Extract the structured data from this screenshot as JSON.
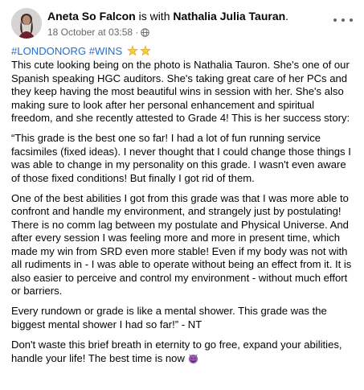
{
  "post": {
    "author": "Aneta So Falcon",
    "with_text": " is with ",
    "tagged": "Nathalia Julia Tauran",
    "tagged_suffix": ".",
    "timestamp": "18 October at 03:58 · ",
    "hashtags": "#LONDONORG #WINS",
    "paragraphs": [
      "This cute looking being on the photo is Nathalia Tauron. She's one of our Spanish speaking HGC auditors. She's taking great care of her PCs and they keep having the most beautiful wins in session with her. She's also making sure to look after her personal enhancement and spiritual freedom, and she recently attested to Grade 4! This is her success story:",
      "“This grade is the best one so far! I had a lot of fun running service facsimiles (fixed ideas). I never thought that I could change those things I was able to change in my personality on this grade. I wasn't even aware of those fixed conditions! But finally I got rid of them.",
      "One of the best abilities I got from this grade was that I was more able to confront and handle my environment, and strangely just by postulating! There is no comm lag between my postulate and Physical Universe. And after every session I was feeling more and more in present time, which made my win from SRD even more stable! Even if my body was not with all rudiments in - I was able to operate without being an effect from it. It is also easier to perceive and control my environment - without much effort or barriers.",
      "Every rundown or grade is like a mental shower. This grade was the biggest mental shower I had so far!” - NT",
      "Don't waste this brief breath in eternity to go free, expand your abilities, handle your life! The best time is now"
    ],
    "icons": {
      "privacy": "globe-icon",
      "hashtag_emoji": "glowing-star-emoji",
      "closing_emoji": "smiling-devil-emoji",
      "menu": "more-options-icon"
    },
    "colors": {
      "hashtag": "#216fdb",
      "meta": "#65676b",
      "text": "#050505"
    }
  }
}
